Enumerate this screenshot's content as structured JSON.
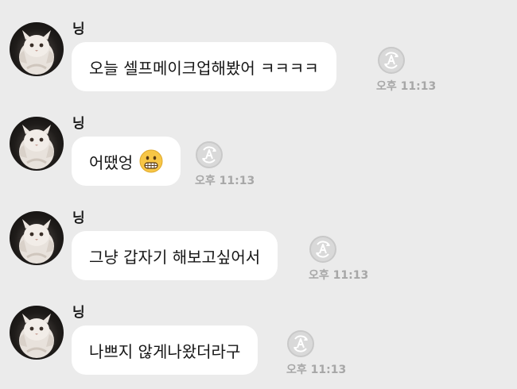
{
  "messages": [
    {
      "sender": "닝",
      "text": "오늘 셀프메이크업해봤어 ㅋㅋㅋㅋ",
      "time": "오후 11:13",
      "emoji": ""
    },
    {
      "sender": "닝",
      "text": "어땠엉",
      "time": "오후 11:13",
      "emoji": "grimacing-face-emoji"
    },
    {
      "sender": "닝",
      "text": "그냥 갑자기 해보고싶어서",
      "time": "오후 11:13",
      "emoji": ""
    },
    {
      "sender": "닝",
      "text": "나쁘지 않게나왔더라구",
      "time": "오후 11:13",
      "emoji": ""
    }
  ],
  "icons": {
    "avatar": "white-cat-photo",
    "translate": "translate-a-icon"
  },
  "colors": {
    "background": "#ebebeb",
    "bubble": "#ffffff",
    "timestamp": "#a7a7a7"
  }
}
